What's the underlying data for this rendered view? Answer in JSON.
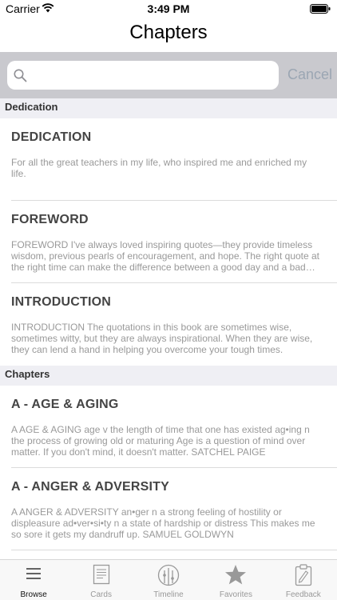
{
  "status_bar": {
    "carrier": "Carrier",
    "time": "3:49 PM"
  },
  "nav": {
    "title": "Chapters"
  },
  "search": {
    "placeholder": "",
    "cancel_label": "Cancel"
  },
  "sections": [
    {
      "header": "Dedication",
      "items": [
        {
          "title": "DEDICATION",
          "body": "For all the great teachers in my life, who inspired me and enriched my life."
        },
        {
          "title": "FOREWORD",
          "body": "FOREWORD I've always loved inspiring quotes—they provide timeless wisdom, previous pearls of encouragement, and hope. The right quote at the right time can make the difference between a good day and a bad one."
        },
        {
          "title": "INTRODUCTION",
          "body": "INTRODUCTION The quotations in this book are sometimes wise, sometimes witty, but they are always inspirational. When they are wise, they can lend a hand in helping you overcome your tough times."
        }
      ]
    },
    {
      "header": "Chapters",
      "items": [
        {
          "title": "A - AGE & AGING",
          "body": "A AGE & AGING age v the length of time that one has existed ag•ing n the process of growing old or maturing     Age is a question of mind over matter. If you don't mind, it doesn't matter. SATCHEL PAIGE"
        },
        {
          "title": "A - ANGER & ADVERSITY",
          "body": "A ANGER & ADVERSITY an•ger n a strong feeling of hostility or displeasure ad•ver•si•ty n a state of hardship or distress     This makes me so sore it gets my dandruff up. SAMUEL GOLDWYN"
        }
      ]
    }
  ],
  "tabs": [
    {
      "label": "Browse",
      "icon": "list-icon",
      "active": true
    },
    {
      "label": "Cards",
      "icon": "cards-icon",
      "active": false
    },
    {
      "label": "Timeline",
      "icon": "timeline-icon",
      "active": false
    },
    {
      "label": "Favorites",
      "icon": "star-icon",
      "active": false
    },
    {
      "label": "Feedback",
      "icon": "clipboard-icon",
      "active": false
    }
  ]
}
